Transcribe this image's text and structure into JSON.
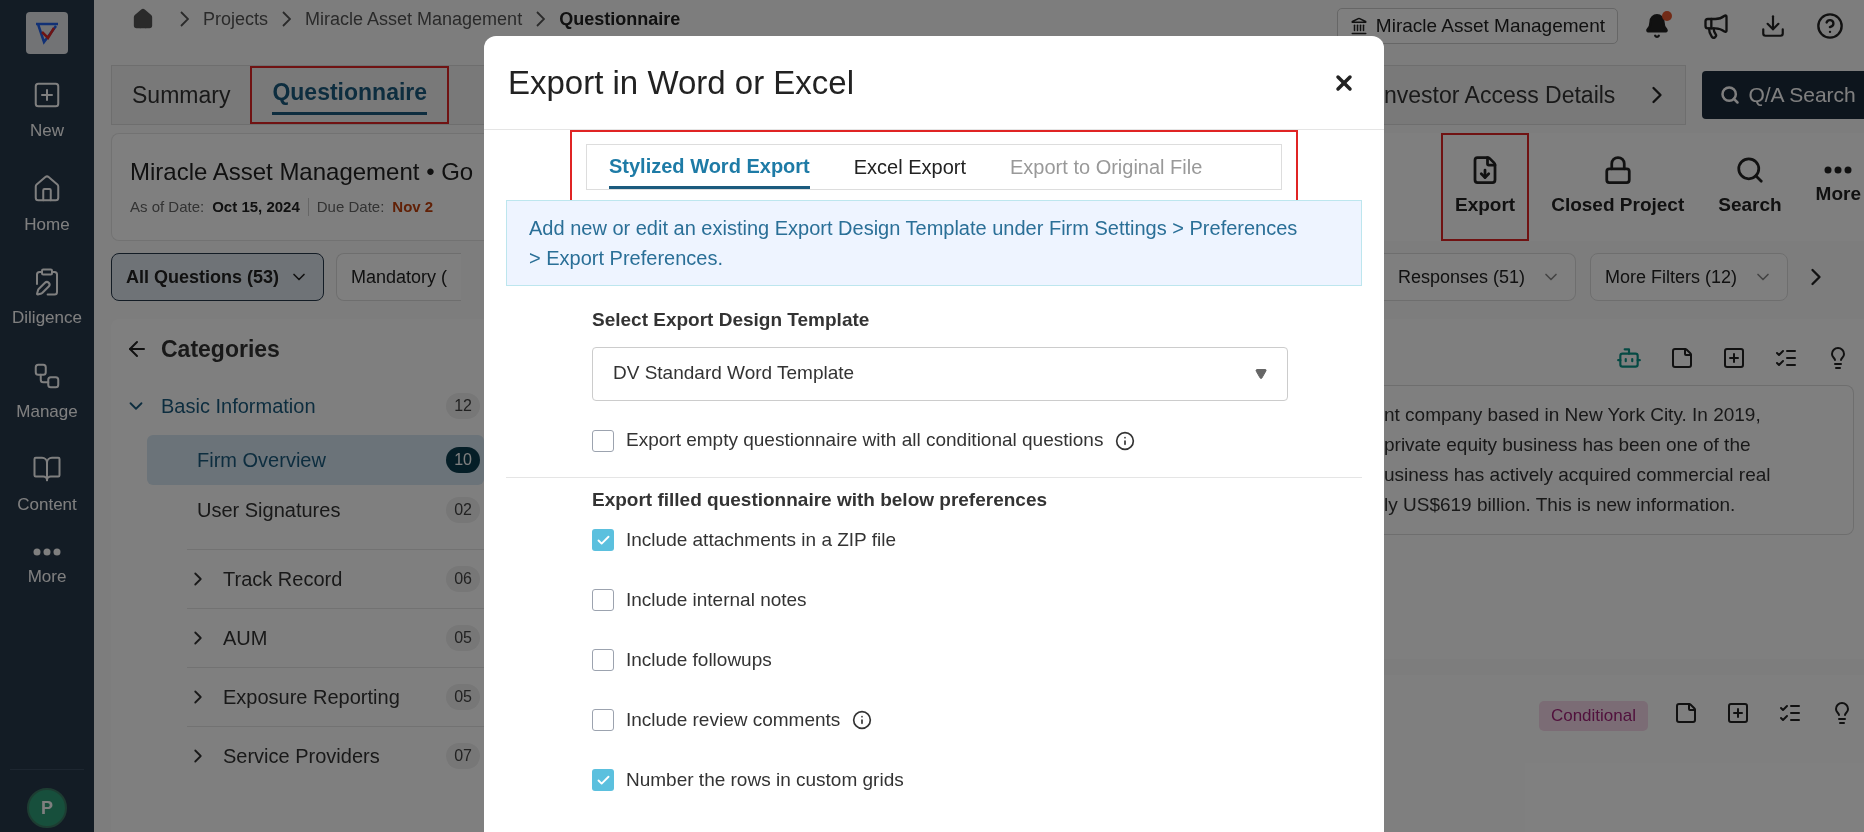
{
  "sidebar": {
    "items": [
      {
        "kind": "new",
        "label": "New"
      },
      {
        "kind": "home",
        "label": "Home"
      },
      {
        "kind": "diligence",
        "label": "Diligence"
      },
      {
        "kind": "manage",
        "label": "Manage"
      },
      {
        "kind": "content",
        "label": "Content"
      },
      {
        "kind": "more",
        "label": "More"
      }
    ],
    "avatar": "P"
  },
  "breadcrumb": [
    "Projects",
    "Miracle Asset Management",
    "Questionnaire"
  ],
  "firm_button": "Miracle Asset Management",
  "notifications": {
    "unread": true
  },
  "tabs": [
    {
      "label": "Summary",
      "selected": false,
      "highlighted": false
    },
    {
      "label": "Questionnaire",
      "selected": true,
      "highlighted": true
    },
    {
      "label": "nvestor Access Details",
      "selected": false,
      "highlighted": false
    }
  ],
  "qa_search": "Q/A Search",
  "project": {
    "title": "Miracle Asset Management • Go",
    "as_of_label": "As of Date:",
    "as_of": "Oct 15, 2024",
    "due_label": "Due Date:",
    "due": "Nov 2"
  },
  "toolbar": [
    {
      "kind": "export",
      "label": "Export",
      "highlighted": true
    },
    {
      "kind": "closed",
      "label": "Closed Project",
      "highlighted": false
    },
    {
      "kind": "search",
      "label": "Search",
      "highlighted": false
    },
    {
      "kind": "more",
      "label": "More",
      "highlighted": false
    }
  ],
  "filters": [
    {
      "label": "All Questions (53)",
      "selected": true
    },
    {
      "label": "Mandatory (",
      "selected": false
    },
    {
      "label": "Responses (51)",
      "selected": false
    },
    {
      "label": "More Filters (12)",
      "selected": false
    }
  ],
  "categories": {
    "title": "Categories",
    "items": [
      {
        "label": "Basic Information",
        "count": "12",
        "expanded": true,
        "children": [
          {
            "label": "Firm Overview",
            "count": "10",
            "selected": true
          },
          {
            "label": "User Signatures",
            "count": "02",
            "selected": false
          }
        ]
      },
      {
        "label": "Track Record",
        "count": "06",
        "expanded": false
      },
      {
        "label": "AUM",
        "count": "05",
        "expanded": false
      },
      {
        "label": "Exposure Reporting",
        "count": "05",
        "expanded": false
      },
      {
        "label": "Service Providers",
        "count": "07",
        "expanded": false
      }
    ]
  },
  "answer": {
    "lines": [
      "nt company based in New York City. In 2019,",
      "private equity business has been one of the",
      "usiness has actively acquired commercial real",
      "ly US$619 billion. This is new information."
    ]
  },
  "question_2": {
    "badge": "Conditional"
  },
  "dialog": {
    "title": "Export in Word or Excel",
    "tabs_highlighted": true,
    "tabs": [
      {
        "label": "Stylized Word Export",
        "selected": true,
        "disabled": false
      },
      {
        "label": "Excel Export",
        "selected": false,
        "disabled": false
      },
      {
        "label": "Export to Original File",
        "selected": false,
        "disabled": true
      }
    ],
    "notice": "Add new or edit an existing Export Design Template under Firm Settings > Preferences > Export Preferences.",
    "template_label": "Select Export Design Template",
    "template_value": "DV Standard Word Template",
    "empty_option": {
      "label": "Export empty questionnaire with all conditional questions",
      "checked": false,
      "info": true
    },
    "filled_heading": "Export filled questionnaire with below preferences",
    "options": [
      {
        "label": "Include attachments in a ZIP file",
        "checked": true,
        "info": false
      },
      {
        "label": "Include internal notes",
        "checked": false,
        "info": false
      },
      {
        "label": "Include followups",
        "checked": false,
        "info": false
      },
      {
        "label": "Include review comments",
        "checked": false,
        "info": true
      },
      {
        "label": "Number the rows in custom grids",
        "checked": true,
        "info": false
      }
    ]
  }
}
